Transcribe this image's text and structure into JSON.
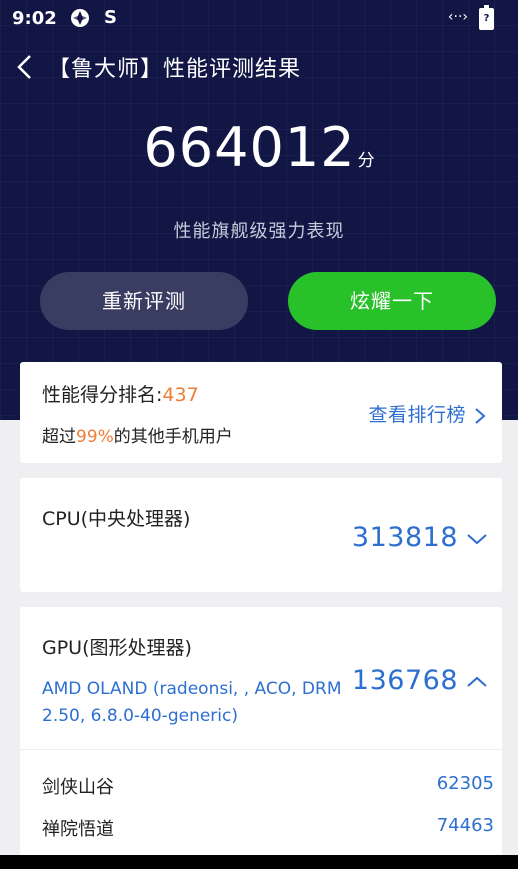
{
  "status": {
    "time": "9:02",
    "sim_label": "S"
  },
  "header": {
    "title": "【鲁大师】性能评测结果"
  },
  "score": {
    "value": "664012",
    "unit": "分",
    "subtitle": "性能旗舰级强力表现"
  },
  "buttons": {
    "retest": "重新评测",
    "share": "炫耀一下"
  },
  "rank": {
    "label": "性能得分排名:",
    "value": "437",
    "prefix": "超过",
    "percent": "99%",
    "suffix": "的其他手机用户",
    "link": "查看排行榜"
  },
  "cpu": {
    "label": "CPU(中央处理器)",
    "score": "313818"
  },
  "gpu": {
    "label": "GPU(图形处理器)",
    "name": "AMD OLAND (radeonsi, , ACO, DRM 2.50, 6.8.0-40-generic)",
    "score": "136768",
    "items": [
      {
        "name": "剑侠山谷",
        "score": "62305"
      },
      {
        "name": "禅院悟道",
        "score": "74463"
      }
    ]
  },
  "colors": {
    "hero_bg": "#121645",
    "accent_blue": "#2d6fd0",
    "green": "#28c12a",
    "orange": "#ef7d36"
  },
  "icons": {
    "back": "back-arrow-icon",
    "cpu_toggle": "chevron-down-icon",
    "gpu_toggle": "chevron-up-icon",
    "link": "chevron-right-icon"
  }
}
